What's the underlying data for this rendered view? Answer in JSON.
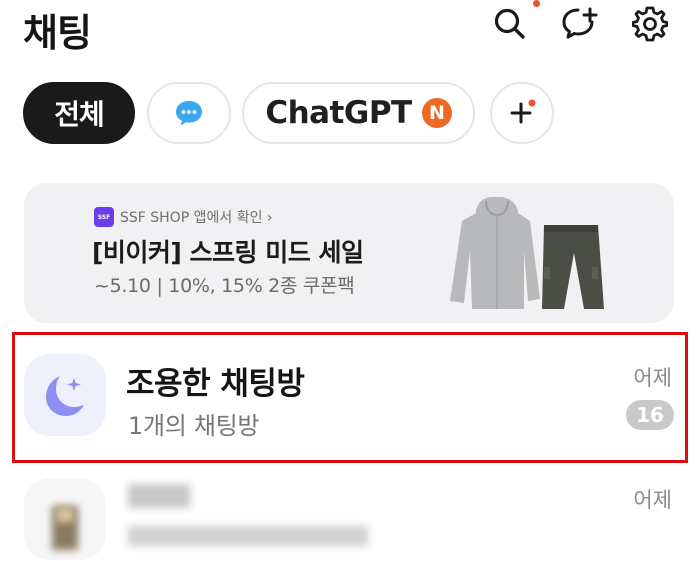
{
  "header": {
    "title": "채팅",
    "icons": [
      "search-icon",
      "new-chat-icon",
      "settings-icon"
    ],
    "notification_dot_color": "#ef4f2c"
  },
  "filters": {
    "chips": [
      {
        "label": "전체",
        "active": true
      },
      {
        "icon": "chat-bubble-icon",
        "active": false
      },
      {
        "label": "ChatGPT",
        "badge": "N",
        "active": false
      },
      {
        "icon": "plus-icon",
        "active": false
      }
    ]
  },
  "ad": {
    "source_logo": "SSF",
    "source": "SSF SHOP 앱에서 확인 ›",
    "title": "[비이커] 스프링 미드 세일",
    "subtitle": "~5.10 | 10%, 15% 2종 쿠폰팩"
  },
  "chats": [
    {
      "name": "조용한 채팅방",
      "preview": "1개의 채팅방",
      "time": "어제",
      "unread": "16",
      "icon": "moon-icon"
    },
    {
      "time": "어제"
    }
  ],
  "colors": {
    "accent": "#1a1a1a",
    "badge_orange": "#ee6a24",
    "chat_bubble_blue": "#3aa7f0",
    "highlight": "#d70f0f"
  }
}
